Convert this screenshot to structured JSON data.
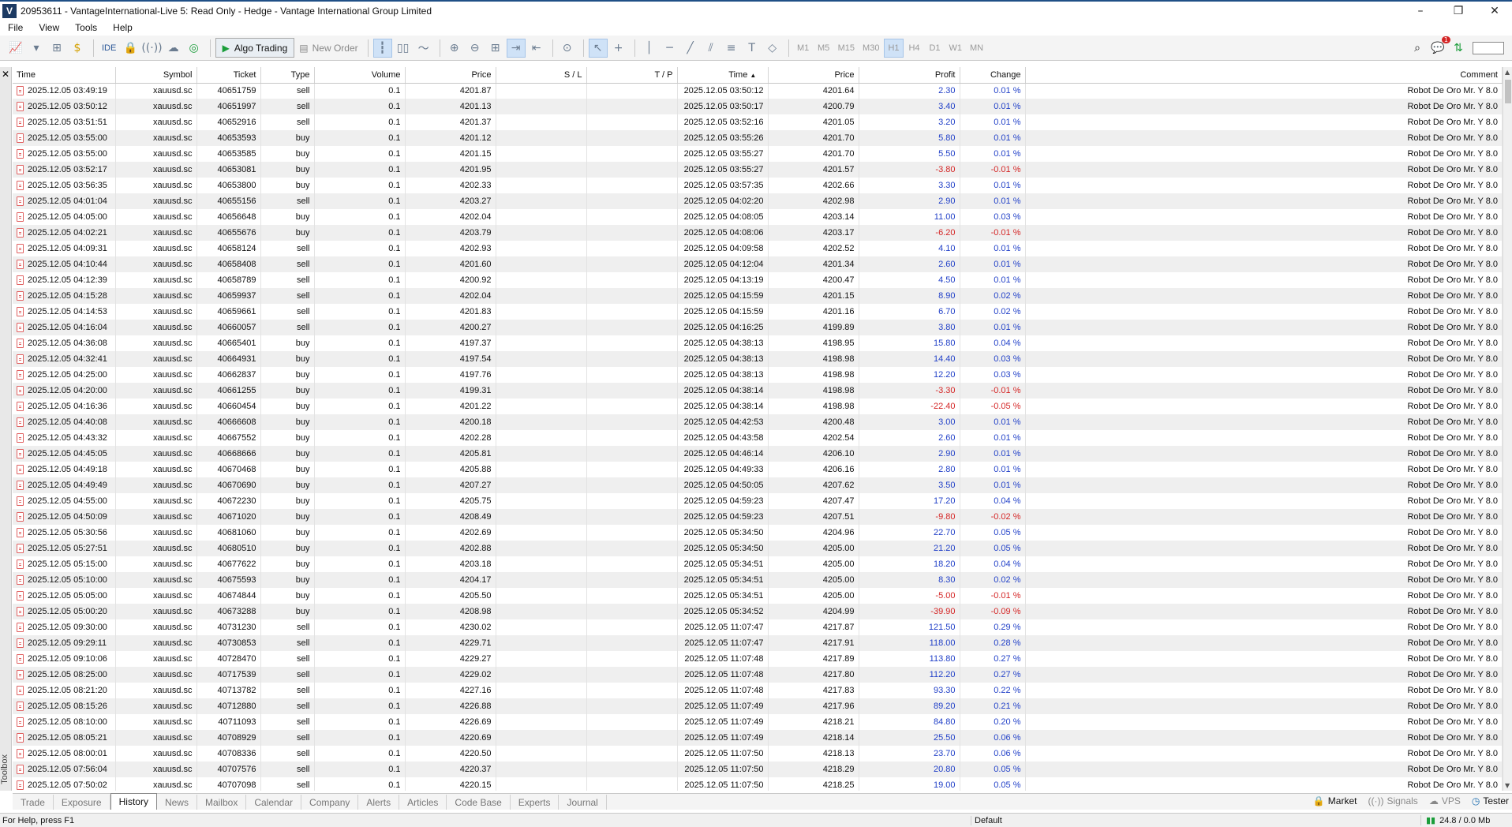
{
  "title": "20953611 - VantageInternational-Live 5: Read Only - Hedge - Vantage International Group Limited",
  "window_controls": {
    "minimize": "–",
    "restore": "❐",
    "close": "✕"
  },
  "menu": [
    "File",
    "View",
    "Tools",
    "Help"
  ],
  "toolbar": {
    "ide": "IDE",
    "algo_trading": "Algo Trading",
    "new_order": "New Order",
    "timeframes": [
      "M1",
      "M5",
      "M15",
      "M30",
      "H1",
      "H4",
      "D1",
      "W1",
      "MN"
    ],
    "active_timeframe": "H1",
    "notification_count": "1"
  },
  "toolbox_label": "Toolbox",
  "table": {
    "columns": [
      "Time",
      "Symbol",
      "Ticket",
      "Type",
      "Volume",
      "Price",
      "S / L",
      "T / P",
      "Time",
      "Price",
      "Profit",
      "Change",
      "Comment"
    ],
    "rows": [
      [
        "2025.12.05 03:49:19",
        "xauusd.sc",
        "40651759",
        "sell",
        "0.1",
        "4201.87",
        "",
        "",
        "2025.12.05 03:50:12",
        "4201.64",
        "2.30",
        "0.01 %",
        "Robot De Oro Mr. Y 8.0"
      ],
      [
        "2025.12.05 03:50:12",
        "xauusd.sc",
        "40651997",
        "sell",
        "0.1",
        "4201.13",
        "",
        "",
        "2025.12.05 03:50:17",
        "4200.79",
        "3.40",
        "0.01 %",
        "Robot De Oro Mr. Y 8.0"
      ],
      [
        "2025.12.05 03:51:51",
        "xauusd.sc",
        "40652916",
        "sell",
        "0.1",
        "4201.37",
        "",
        "",
        "2025.12.05 03:52:16",
        "4201.05",
        "3.20",
        "0.01 %",
        "Robot De Oro Mr. Y 8.0"
      ],
      [
        "2025.12.05 03:55:00",
        "xauusd.sc",
        "40653593",
        "buy",
        "0.1",
        "4201.12",
        "",
        "",
        "2025.12.05 03:55:26",
        "4201.70",
        "5.80",
        "0.01 %",
        "Robot De Oro Mr. Y 8.0"
      ],
      [
        "2025.12.05 03:55:00",
        "xauusd.sc",
        "40653585",
        "buy",
        "0.1",
        "4201.15",
        "",
        "",
        "2025.12.05 03:55:27",
        "4201.70",
        "5.50",
        "0.01 %",
        "Robot De Oro Mr. Y 8.0"
      ],
      [
        "2025.12.05 03:52:17",
        "xauusd.sc",
        "40653081",
        "buy",
        "0.1",
        "4201.95",
        "",
        "",
        "2025.12.05 03:55:27",
        "4201.57",
        "-3.80",
        "-0.01 %",
        "Robot De Oro Mr. Y 8.0"
      ],
      [
        "2025.12.05 03:56:35",
        "xauusd.sc",
        "40653800",
        "buy",
        "0.1",
        "4202.33",
        "",
        "",
        "2025.12.05 03:57:35",
        "4202.66",
        "3.30",
        "0.01 %",
        "Robot De Oro Mr. Y 8.0"
      ],
      [
        "2025.12.05 04:01:04",
        "xauusd.sc",
        "40655156",
        "sell",
        "0.1",
        "4203.27",
        "",
        "",
        "2025.12.05 04:02:20",
        "4202.98",
        "2.90",
        "0.01 %",
        "Robot De Oro Mr. Y 8.0"
      ],
      [
        "2025.12.05 04:05:00",
        "xauusd.sc",
        "40656648",
        "buy",
        "0.1",
        "4202.04",
        "",
        "",
        "2025.12.05 04:08:05",
        "4203.14",
        "11.00",
        "0.03 %",
        "Robot De Oro Mr. Y 8.0"
      ],
      [
        "2025.12.05 04:02:21",
        "xauusd.sc",
        "40655676",
        "buy",
        "0.1",
        "4203.79",
        "",
        "",
        "2025.12.05 04:08:06",
        "4203.17",
        "-6.20",
        "-0.01 %",
        "Robot De Oro Mr. Y 8.0"
      ],
      [
        "2025.12.05 04:09:31",
        "xauusd.sc",
        "40658124",
        "sell",
        "0.1",
        "4202.93",
        "",
        "",
        "2025.12.05 04:09:58",
        "4202.52",
        "4.10",
        "0.01 %",
        "Robot De Oro Mr. Y 8.0"
      ],
      [
        "2025.12.05 04:10:44",
        "xauusd.sc",
        "40658408",
        "sell",
        "0.1",
        "4201.60",
        "",
        "",
        "2025.12.05 04:12:04",
        "4201.34",
        "2.60",
        "0.01 %",
        "Robot De Oro Mr. Y 8.0"
      ],
      [
        "2025.12.05 04:12:39",
        "xauusd.sc",
        "40658789",
        "sell",
        "0.1",
        "4200.92",
        "",
        "",
        "2025.12.05 04:13:19",
        "4200.47",
        "4.50",
        "0.01 %",
        "Robot De Oro Mr. Y 8.0"
      ],
      [
        "2025.12.05 04:15:28",
        "xauusd.sc",
        "40659937",
        "sell",
        "0.1",
        "4202.04",
        "",
        "",
        "2025.12.05 04:15:59",
        "4201.15",
        "8.90",
        "0.02 %",
        "Robot De Oro Mr. Y 8.0"
      ],
      [
        "2025.12.05 04:14:53",
        "xauusd.sc",
        "40659661",
        "sell",
        "0.1",
        "4201.83",
        "",
        "",
        "2025.12.05 04:15:59",
        "4201.16",
        "6.70",
        "0.02 %",
        "Robot De Oro Mr. Y 8.0"
      ],
      [
        "2025.12.05 04:16:04",
        "xauusd.sc",
        "40660057",
        "sell",
        "0.1",
        "4200.27",
        "",
        "",
        "2025.12.05 04:16:25",
        "4199.89",
        "3.80",
        "0.01 %",
        "Robot De Oro Mr. Y 8.0"
      ],
      [
        "2025.12.05 04:36:08",
        "xauusd.sc",
        "40665401",
        "buy",
        "0.1",
        "4197.37",
        "",
        "",
        "2025.12.05 04:38:13",
        "4198.95",
        "15.80",
        "0.04 %",
        "Robot De Oro Mr. Y 8.0"
      ],
      [
        "2025.12.05 04:32:41",
        "xauusd.sc",
        "40664931",
        "buy",
        "0.1",
        "4197.54",
        "",
        "",
        "2025.12.05 04:38:13",
        "4198.98",
        "14.40",
        "0.03 %",
        "Robot De Oro Mr. Y 8.0"
      ],
      [
        "2025.12.05 04:25:00",
        "xauusd.sc",
        "40662837",
        "buy",
        "0.1",
        "4197.76",
        "",
        "",
        "2025.12.05 04:38:13",
        "4198.98",
        "12.20",
        "0.03 %",
        "Robot De Oro Mr. Y 8.0"
      ],
      [
        "2025.12.05 04:20:00",
        "xauusd.sc",
        "40661255",
        "buy",
        "0.1",
        "4199.31",
        "",
        "",
        "2025.12.05 04:38:14",
        "4198.98",
        "-3.30",
        "-0.01 %",
        "Robot De Oro Mr. Y 8.0"
      ],
      [
        "2025.12.05 04:16:36",
        "xauusd.sc",
        "40660454",
        "buy",
        "0.1",
        "4201.22",
        "",
        "",
        "2025.12.05 04:38:14",
        "4198.98",
        "-22.40",
        "-0.05 %",
        "Robot De Oro Mr. Y 8.0"
      ],
      [
        "2025.12.05 04:40:08",
        "xauusd.sc",
        "40666608",
        "buy",
        "0.1",
        "4200.18",
        "",
        "",
        "2025.12.05 04:42:53",
        "4200.48",
        "3.00",
        "0.01 %",
        "Robot De Oro Mr. Y 8.0"
      ],
      [
        "2025.12.05 04:43:32",
        "xauusd.sc",
        "40667552",
        "buy",
        "0.1",
        "4202.28",
        "",
        "",
        "2025.12.05 04:43:58",
        "4202.54",
        "2.60",
        "0.01 %",
        "Robot De Oro Mr. Y 8.0"
      ],
      [
        "2025.12.05 04:45:05",
        "xauusd.sc",
        "40668666",
        "buy",
        "0.1",
        "4205.81",
        "",
        "",
        "2025.12.05 04:46:14",
        "4206.10",
        "2.90",
        "0.01 %",
        "Robot De Oro Mr. Y 8.0"
      ],
      [
        "2025.12.05 04:49:18",
        "xauusd.sc",
        "40670468",
        "buy",
        "0.1",
        "4205.88",
        "",
        "",
        "2025.12.05 04:49:33",
        "4206.16",
        "2.80",
        "0.01 %",
        "Robot De Oro Mr. Y 8.0"
      ],
      [
        "2025.12.05 04:49:49",
        "xauusd.sc",
        "40670690",
        "buy",
        "0.1",
        "4207.27",
        "",
        "",
        "2025.12.05 04:50:05",
        "4207.62",
        "3.50",
        "0.01 %",
        "Robot De Oro Mr. Y 8.0"
      ],
      [
        "2025.12.05 04:55:00",
        "xauusd.sc",
        "40672230",
        "buy",
        "0.1",
        "4205.75",
        "",
        "",
        "2025.12.05 04:59:23",
        "4207.47",
        "17.20",
        "0.04 %",
        "Robot De Oro Mr. Y 8.0"
      ],
      [
        "2025.12.05 04:50:09",
        "xauusd.sc",
        "40671020",
        "buy",
        "0.1",
        "4208.49",
        "",
        "",
        "2025.12.05 04:59:23",
        "4207.51",
        "-9.80",
        "-0.02 %",
        "Robot De Oro Mr. Y 8.0"
      ],
      [
        "2025.12.05 05:30:56",
        "xauusd.sc",
        "40681060",
        "buy",
        "0.1",
        "4202.69",
        "",
        "",
        "2025.12.05 05:34:50",
        "4204.96",
        "22.70",
        "0.05 %",
        "Robot De Oro Mr. Y 8.0"
      ],
      [
        "2025.12.05 05:27:51",
        "xauusd.sc",
        "40680510",
        "buy",
        "0.1",
        "4202.88",
        "",
        "",
        "2025.12.05 05:34:50",
        "4205.00",
        "21.20",
        "0.05 %",
        "Robot De Oro Mr. Y 8.0"
      ],
      [
        "2025.12.05 05:15:00",
        "xauusd.sc",
        "40677622",
        "buy",
        "0.1",
        "4203.18",
        "",
        "",
        "2025.12.05 05:34:51",
        "4205.00",
        "18.20",
        "0.04 %",
        "Robot De Oro Mr. Y 8.0"
      ],
      [
        "2025.12.05 05:10:00",
        "xauusd.sc",
        "40675593",
        "buy",
        "0.1",
        "4204.17",
        "",
        "",
        "2025.12.05 05:34:51",
        "4205.00",
        "8.30",
        "0.02 %",
        "Robot De Oro Mr. Y 8.0"
      ],
      [
        "2025.12.05 05:05:00",
        "xauusd.sc",
        "40674844",
        "buy",
        "0.1",
        "4205.50",
        "",
        "",
        "2025.12.05 05:34:51",
        "4205.00",
        "-5.00",
        "-0.01 %",
        "Robot De Oro Mr. Y 8.0"
      ],
      [
        "2025.12.05 05:00:20",
        "xauusd.sc",
        "40673288",
        "buy",
        "0.1",
        "4208.98",
        "",
        "",
        "2025.12.05 05:34:52",
        "4204.99",
        "-39.90",
        "-0.09 %",
        "Robot De Oro Mr. Y 8.0"
      ],
      [
        "2025.12.05 09:30:00",
        "xauusd.sc",
        "40731230",
        "sell",
        "0.1",
        "4230.02",
        "",
        "",
        "2025.12.05 11:07:47",
        "4217.87",
        "121.50",
        "0.29 %",
        "Robot De Oro Mr. Y 8.0"
      ],
      [
        "2025.12.05 09:29:11",
        "xauusd.sc",
        "40730853",
        "sell",
        "0.1",
        "4229.71",
        "",
        "",
        "2025.12.05 11:07:47",
        "4217.91",
        "118.00",
        "0.28 %",
        "Robot De Oro Mr. Y 8.0"
      ],
      [
        "2025.12.05 09:10:06",
        "xauusd.sc",
        "40728470",
        "sell",
        "0.1",
        "4229.27",
        "",
        "",
        "2025.12.05 11:07:48",
        "4217.89",
        "113.80",
        "0.27 %",
        "Robot De Oro Mr. Y 8.0"
      ],
      [
        "2025.12.05 08:25:00",
        "xauusd.sc",
        "40717539",
        "sell",
        "0.1",
        "4229.02",
        "",
        "",
        "2025.12.05 11:07:48",
        "4217.80",
        "112.20",
        "0.27 %",
        "Robot De Oro Mr. Y 8.0"
      ],
      [
        "2025.12.05 08:21:20",
        "xauusd.sc",
        "40713782",
        "sell",
        "0.1",
        "4227.16",
        "",
        "",
        "2025.12.05 11:07:48",
        "4217.83",
        "93.30",
        "0.22 %",
        "Robot De Oro Mr. Y 8.0"
      ],
      [
        "2025.12.05 08:15:26",
        "xauusd.sc",
        "40712880",
        "sell",
        "0.1",
        "4226.88",
        "",
        "",
        "2025.12.05 11:07:49",
        "4217.96",
        "89.20",
        "0.21 %",
        "Robot De Oro Mr. Y 8.0"
      ],
      [
        "2025.12.05 08:10:00",
        "xauusd.sc",
        "40711093",
        "sell",
        "0.1",
        "4226.69",
        "",
        "",
        "2025.12.05 11:07:49",
        "4218.21",
        "84.80",
        "0.20 %",
        "Robot De Oro Mr. Y 8.0"
      ],
      [
        "2025.12.05 08:05:21",
        "xauusd.sc",
        "40708929",
        "sell",
        "0.1",
        "4220.69",
        "",
        "",
        "2025.12.05 11:07:49",
        "4218.14",
        "25.50",
        "0.06 %",
        "Robot De Oro Mr. Y 8.0"
      ],
      [
        "2025.12.05 08:00:01",
        "xauusd.sc",
        "40708336",
        "sell",
        "0.1",
        "4220.50",
        "",
        "",
        "2025.12.05 11:07:50",
        "4218.13",
        "23.70",
        "0.06 %",
        "Robot De Oro Mr. Y 8.0"
      ],
      [
        "2025.12.05 07:56:04",
        "xauusd.sc",
        "40707576",
        "sell",
        "0.1",
        "4220.37",
        "",
        "",
        "2025.12.05 11:07:50",
        "4218.29",
        "20.80",
        "0.05 %",
        "Robot De Oro Mr. Y 8.0"
      ],
      [
        "2025.12.05 07:50:02",
        "xauusd.sc",
        "40707098",
        "sell",
        "0.1",
        "4220.15",
        "",
        "",
        "2025.12.05 11:07:50",
        "4218.25",
        "19.00",
        "0.05 %",
        "Robot De Oro Mr. Y 8.0"
      ]
    ]
  },
  "bottom_tabs": [
    "Trade",
    "Exposure",
    "History",
    "News",
    "Mailbox",
    "Calendar",
    "Company",
    "Alerts",
    "Articles",
    "Code Base",
    "Experts",
    "Journal"
  ],
  "active_tab": "History",
  "right_tabs": [
    "Market",
    "Signals",
    "VPS",
    "Tester"
  ],
  "status": {
    "help": "For Help, press F1",
    "profile": "Default",
    "traffic": "24.8 / 0.0 Mb"
  },
  "colors": {
    "positive": "#2140c8",
    "negative": "#d42525",
    "title_accent": "#1f4f86"
  }
}
